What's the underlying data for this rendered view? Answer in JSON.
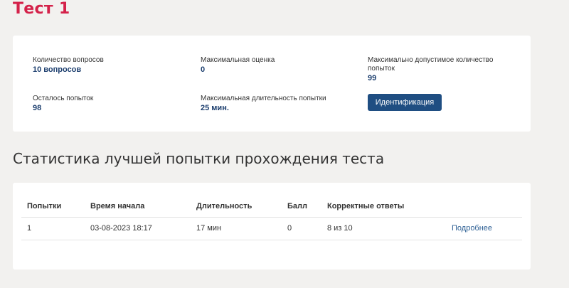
{
  "page_title": "Тест 1",
  "info": {
    "questions_count": {
      "label": "Количество вопросов",
      "value": "10 вопросов"
    },
    "max_score": {
      "label": "Максимальная оценка",
      "value": "0"
    },
    "max_attempts": {
      "label": "Максимально допустимое количество попыток",
      "value": "99"
    },
    "attempts_left": {
      "label": "Осталось попыток",
      "value": "98"
    },
    "max_duration": {
      "label": "Максимальная длительность попытки",
      "value": "25 мин."
    },
    "identify_button": "Идентификация"
  },
  "stats": {
    "title": "Статистика лучшей попытки прохождения теста",
    "columns": [
      "Попытки",
      "Время начала",
      "Длительность",
      "Балл",
      "Корректные ответы",
      ""
    ],
    "rows": [
      {
        "attempt": "1",
        "start_time": "03-08-2023 18:17",
        "duration": "17 мин",
        "score": "0",
        "correct": "8 из 10",
        "details_link": "Подробнее"
      }
    ]
  },
  "colors": {
    "title_accent": "#d4224a",
    "value_text": "#1c3e6e",
    "button_bg": "#1f4e82",
    "link": "#2d5f94",
    "page_bg": "#f2f1ef"
  }
}
